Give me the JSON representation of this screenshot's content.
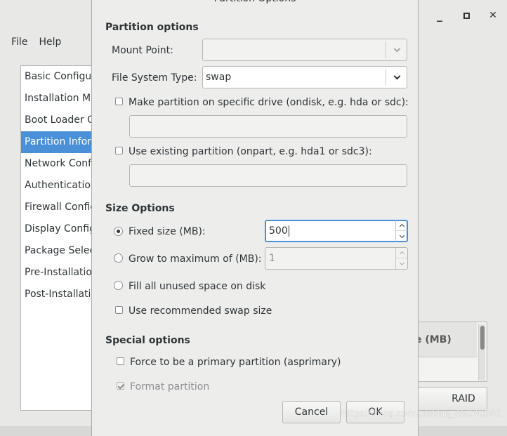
{
  "main_window": {
    "menu": [
      "File",
      "Help"
    ],
    "sidebar_items": [
      "Basic Configura",
      "Installation Me",
      "Boot Loader Op",
      "Partition Inform",
      "Network Confi",
      "Authentication",
      "Firewall Config",
      "Display Configu",
      "Package Select",
      "Pre-Installatio",
      "Post-Installatio"
    ],
    "selected_sidebar_index": 3,
    "table_header_fragment": "e (MB)",
    "raid_button": "RAID"
  },
  "dialog": {
    "title": "Partition Options",
    "partition_options_heading": "Partition options",
    "mount_point_label": "Mount Point:",
    "mount_point_value": "",
    "fs_type_label": "File System Type:",
    "fs_type_value": "swap",
    "ondisk_label": "Make partition on specific drive (ondisk, e.g. hda or sdc):",
    "ondisk_checked": false,
    "onpart_label": "Use existing partition (onpart, e.g. hda1 or sdc3):",
    "onpart_checked": false,
    "size_options_heading": "Size Options",
    "fixed_size_label": "Fixed size (MB):",
    "fixed_size_value": "500",
    "grow_label": "Grow to maximum of (MB):",
    "grow_value": "1",
    "fill_label": "Fill all unused space on disk",
    "recommended_swap_label": "Use recommended swap size",
    "recommended_swap_checked": false,
    "size_option_selected": "fixed",
    "special_options_heading": "Special options",
    "primary_label": "Force to be a primary partition (asprimary)",
    "primary_checked": false,
    "format_label": "Format partition",
    "format_checked": true,
    "cancel_button": "Cancel",
    "ok_button": "OK"
  },
  "watermark": "https://blog.csdn.net/qq_45070541"
}
